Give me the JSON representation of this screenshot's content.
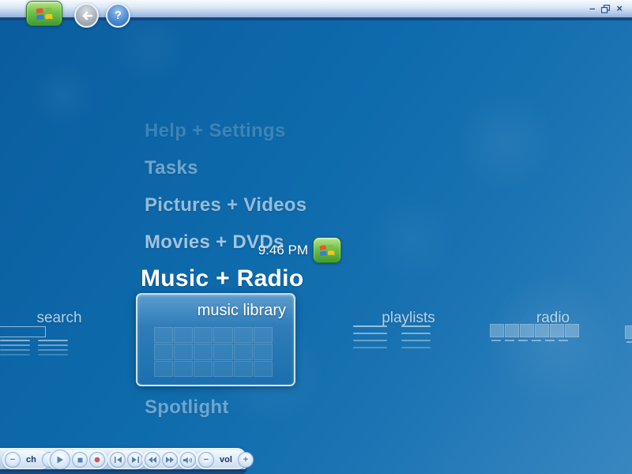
{
  "app": {
    "name": "Windows Media Center"
  },
  "window": {
    "controls": {
      "minimize_glyph": "–",
      "close_glyph": "×"
    }
  },
  "topbar": {
    "help_glyph": "?"
  },
  "clock": {
    "time": "9:46 PM"
  },
  "main_menu": {
    "items": [
      {
        "label": "Help + Settings"
      },
      {
        "label": "Tasks"
      },
      {
        "label": "Pictures + Videos"
      },
      {
        "label": "Movies + DVDs"
      },
      {
        "label": "Music + Radio",
        "selected": true
      },
      {
        "label": "Spotlight"
      }
    ],
    "selected": "Music + Radio"
  },
  "submenu": {
    "parent": "Music + Radio",
    "selected": "music library",
    "items": [
      {
        "label": "search"
      },
      {
        "label": "music library",
        "selected": true
      },
      {
        "label": "playlists"
      },
      {
        "label": "radio"
      }
    ]
  },
  "toolbar": {
    "channel_label": "ch",
    "volume_label": "vol",
    "minus_glyph": "−",
    "plus_glyph": "+",
    "buttons": [
      "channel-down",
      "channel-up",
      "play",
      "stop",
      "record",
      "previous",
      "next",
      "rewind",
      "fast-forward",
      "mute",
      "volume-down",
      "volume-up"
    ]
  },
  "colors": {
    "background_top": "#0a5d9e",
    "background_bottom": "#3987c1",
    "bar_dark": "#123a6e",
    "start_green": "#3f9a2e",
    "record_red": "#c9595e",
    "selection_white": "#ffffff"
  }
}
